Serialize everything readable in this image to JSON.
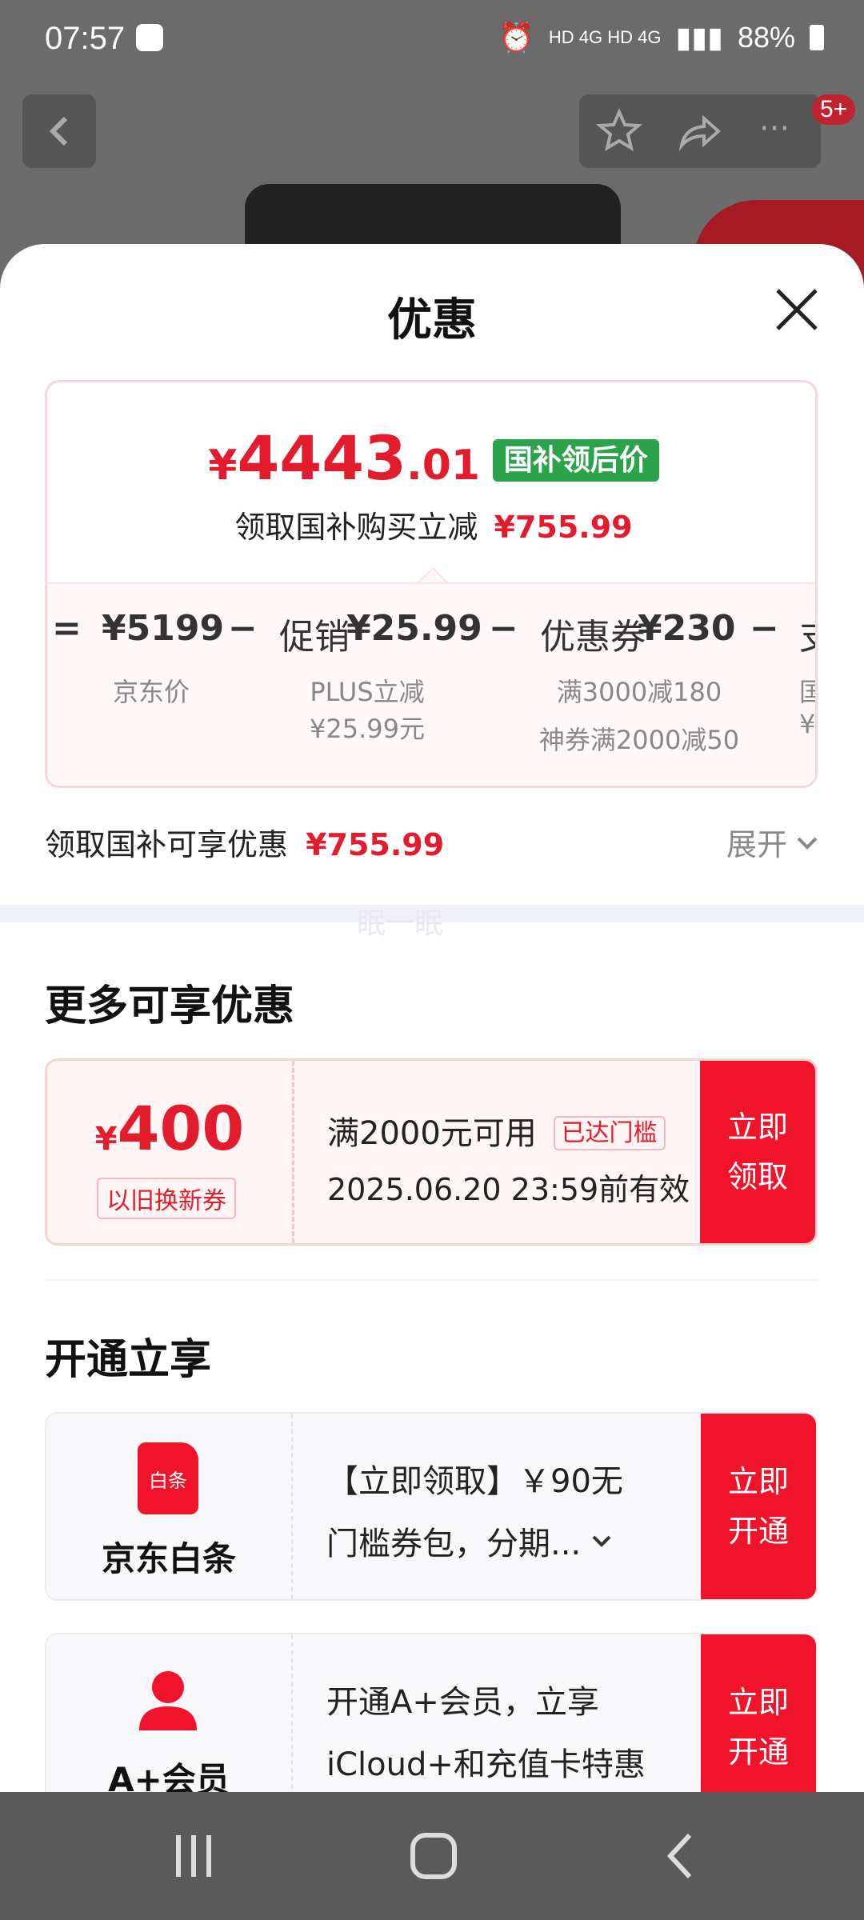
{
  "status_bar": {
    "time": "07:57",
    "indicators": "HD 4G HD 4G",
    "battery": "88%"
  },
  "background": {
    "notification_count": "5+"
  },
  "sheet": {
    "title": "优惠",
    "price": {
      "currency": "¥",
      "integer": "4443",
      "decimal": ".01",
      "tag": "国补领后价",
      "saving_text": "领取国补购买立减",
      "saving_amount": "¥755.99"
    },
    "breakdown": [
      {
        "op": "=",
        "label": "",
        "value": "¥5199",
        "sub1": "京东价",
        "sub2": ""
      },
      {
        "op": "−",
        "label": "促销",
        "value": "¥25.99",
        "sub1": "PLUS立减",
        "sub2": "¥25.99元"
      },
      {
        "op": "−",
        "label": "优惠券",
        "value": "¥230",
        "sub1": "满3000减180",
        "sub2": "神券满2000减50"
      },
      {
        "op": "−",
        "label": "支",
        "value": "",
        "sub1": "国",
        "sub2": "¥"
      }
    ],
    "summary": {
      "label": "领取国补可享优惠",
      "amount": "¥755.99",
      "expand": "展开"
    },
    "watermark": "眠一眠",
    "more_title": "更多可享优惠",
    "coupon": {
      "currency": "¥",
      "amount": "400",
      "type": "以旧换新券",
      "condition": "满2000元可用",
      "status": "已达门槛",
      "expiry": "2025.06.20 23:59前有效",
      "button": "立即\n领取"
    },
    "open_title": "开通立享",
    "offers": [
      {
        "icon_label": "白条",
        "name": "京东白条",
        "desc_line1": "【立即领取】￥90无",
        "desc_line2": "门槛券包，分期...",
        "button": "立即\n开通"
      },
      {
        "icon_label": "",
        "name": "A+会员",
        "desc_line1": "开通A+会员，立享",
        "desc_line2": "iCloud+和充值卡特惠",
        "button": "立即\n开通"
      }
    ]
  },
  "colors": {
    "accent": "#e31c2d",
    "button": "#f1132a",
    "tag_green": "#2aa34a"
  }
}
